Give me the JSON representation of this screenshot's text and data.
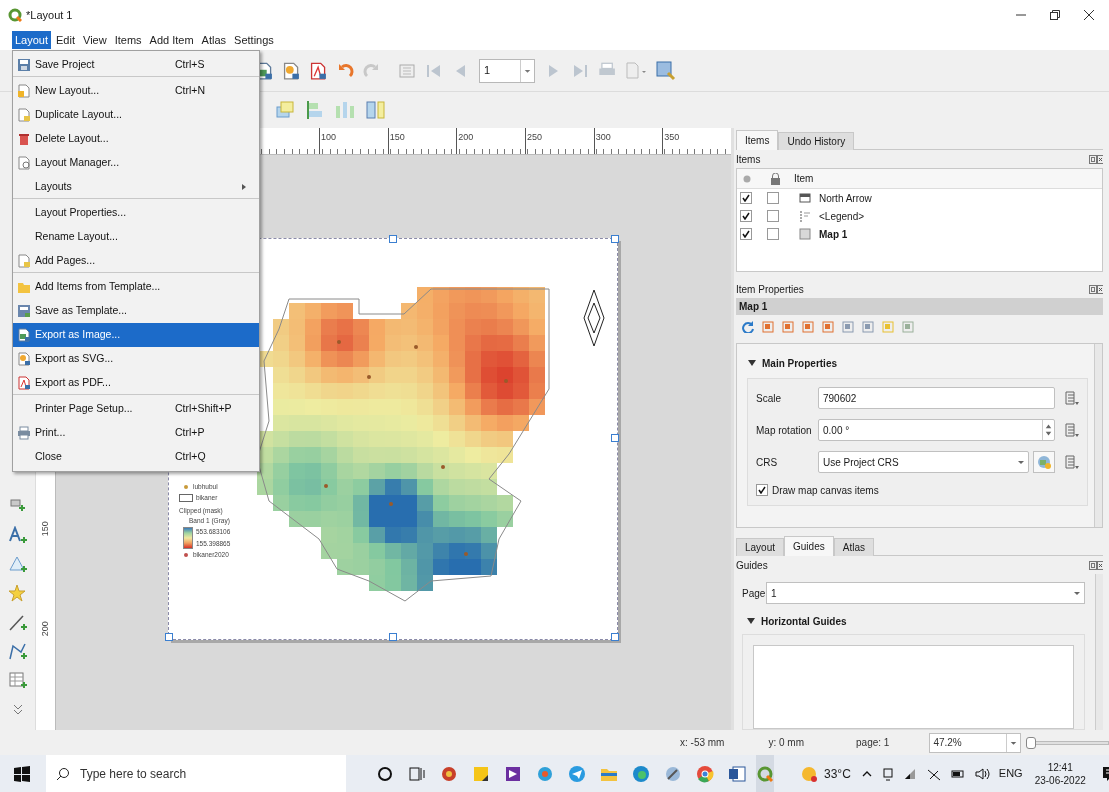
{
  "window": {
    "title": "*Layout 1"
  },
  "menubar": [
    {
      "label": "Layout",
      "selected": true
    },
    {
      "label": "Edit",
      "selected": false
    },
    {
      "label": "View",
      "selected": false
    },
    {
      "label": "Items",
      "selected": false
    },
    {
      "label": "Add Item",
      "selected": false
    },
    {
      "label": "Atlas",
      "selected": false
    },
    {
      "label": "Settings",
      "selected": false
    }
  ],
  "layout_menu": [
    {
      "label": "Save Project",
      "shortcut": "Ctrl+S",
      "selected": false,
      "submenu": false,
      "separator_after": true
    },
    {
      "label": "New Layout...",
      "shortcut": "Ctrl+N",
      "selected": false,
      "submenu": false,
      "separator_after": false
    },
    {
      "label": "Duplicate Layout...",
      "selected": false,
      "submenu": false,
      "separator_after": false
    },
    {
      "label": "Delete Layout...",
      "selected": false,
      "submenu": false,
      "separator_after": false
    },
    {
      "label": "Layout Manager...",
      "selected": false,
      "submenu": false,
      "separator_after": false
    },
    {
      "label": "Layouts",
      "selected": false,
      "submenu": true,
      "separator_after": true
    },
    {
      "label": "Layout Properties...",
      "selected": false,
      "submenu": false,
      "separator_after": false
    },
    {
      "label": "Rename Layout...",
      "selected": false,
      "submenu": false,
      "separator_after": false
    },
    {
      "label": "Add Pages...",
      "selected": false,
      "submenu": false,
      "separator_after": true
    },
    {
      "label": "Add Items from Template...",
      "selected": false,
      "submenu": false,
      "separator_after": false
    },
    {
      "label": "Save as Template...",
      "selected": false,
      "submenu": false,
      "separator_after": false
    },
    {
      "label": "Export as Image...",
      "selected": true,
      "submenu": false,
      "separator_after": false
    },
    {
      "label": "Export as SVG...",
      "selected": false,
      "submenu": false,
      "separator_after": false
    },
    {
      "label": "Export as PDF...",
      "selected": false,
      "submenu": false,
      "separator_after": true
    },
    {
      "label": "Printer Page Setup...",
      "shortcut": "Ctrl+Shift+P",
      "selected": false,
      "submenu": false,
      "separator_after": false
    },
    {
      "label": "Print...",
      "shortcut": "Ctrl+P",
      "selected": false,
      "submenu": false,
      "separator_after": false
    },
    {
      "label": "Close",
      "shortcut": "Ctrl+Q",
      "selected": false,
      "submenu": false,
      "separator_after": false
    }
  ],
  "toolbar": {
    "page_spinbox": "1"
  },
  "ruler": {
    "horizontal": [
      "100",
      "150",
      "200",
      "250",
      "300",
      "350"
    ],
    "vertical": [
      "150",
      "200"
    ]
  },
  "legend": {
    "entries": [
      {
        "kind": "point",
        "label": "lubhubul",
        "color": "#c89a3a"
      },
      {
        "kind": "polygon",
        "label": "bikaner"
      },
      {
        "kind": "heading",
        "label": "Clipped (mask)"
      },
      {
        "kind": "subheading",
        "label": "Band 1 (Gray)"
      },
      {
        "kind": "ramp",
        "labels": [
          "553.683106",
          "155.398865"
        ]
      },
      {
        "kind": "point",
        "label": "bikaner2020",
        "color": "#c0504d"
      }
    ]
  },
  "items_panel": {
    "tabs": [
      {
        "label": "Items",
        "selected": true
      },
      {
        "label": "Undo History",
        "selected": false
      }
    ],
    "title": "Items",
    "column": "Item",
    "rows": [
      {
        "kind": "picture",
        "label": "North Arrow",
        "visible": true,
        "locked": false,
        "selected": false
      },
      {
        "kind": "legend",
        "label": "<Legend>",
        "visible": true,
        "locked": false,
        "selected": false
      },
      {
        "kind": "map",
        "label": "Map 1",
        "visible": true,
        "locked": false,
        "selected": true
      }
    ]
  },
  "item_properties": {
    "title": "Item Properties",
    "item_name": "Map 1",
    "section": {
      "title": "Main Properties",
      "expanded": true
    },
    "scale": {
      "label": "Scale",
      "value": "790602"
    },
    "rotation": {
      "label": "Map rotation",
      "value": "0.00 °"
    },
    "crs": {
      "label": "CRS",
      "value": "Use Project CRS"
    },
    "draw_canvas_items": {
      "label": "Draw map canvas items",
      "checked": true
    }
  },
  "guides_panel": {
    "tabs": [
      {
        "label": "Layout",
        "selected": false
      },
      {
        "label": "Guides",
        "selected": true
      },
      {
        "label": "Atlas",
        "selected": false
      }
    ],
    "title": "Guides",
    "page": {
      "label": "Page",
      "value": "1"
    },
    "section": {
      "title": "Horizontal Guides",
      "expanded": true
    }
  },
  "status_bar": {
    "x": "x: -53 mm",
    "y": "y: 0 mm",
    "page": "page: 1",
    "zoom": "47.2%",
    "zoom_slider": {
      "level": 0.03
    }
  },
  "taskbar": {
    "search_placeholder": "Type here to search",
    "weather": "33°C",
    "language": "ENG",
    "time": "12:41",
    "date": "23-06-2022"
  }
}
